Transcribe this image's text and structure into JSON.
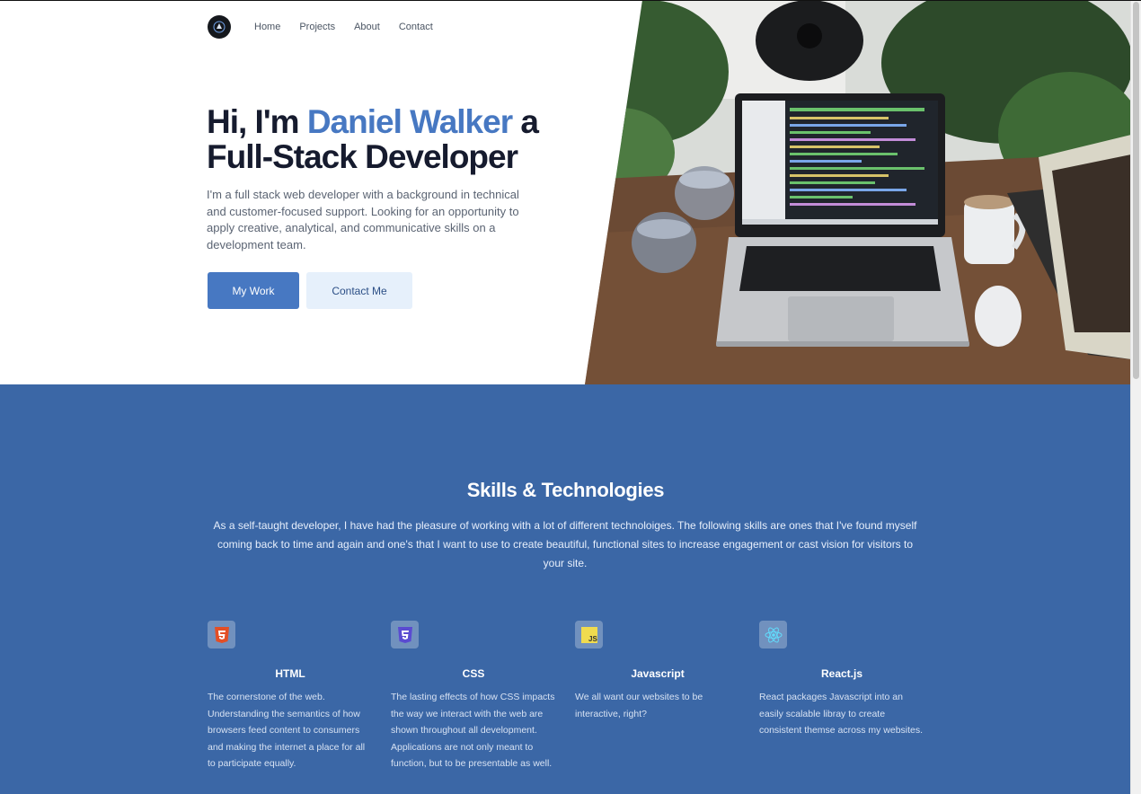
{
  "nav": {
    "logo_alt": "logo",
    "items": [
      "Home",
      "Projects",
      "About",
      "Contact"
    ]
  },
  "hero": {
    "title_prefix": "Hi, I'm ",
    "name": "Daniel Walker",
    "title_suffix_1": " a",
    "title_line2": "Full-Stack Developer",
    "description": "I'm a full stack web developer with a background in technical and customer-focused support. Looking for an opportunity to apply creative, analytical, and communicative skills on a development team.",
    "primary_button": "My Work",
    "secondary_button": "Contact Me",
    "photo_icon": "laptop-desk-photo"
  },
  "skills": {
    "title": "Skills & Technologies",
    "intro": "As a self-taught developer, I have had the pleasure of working with a lot of different technoloiges. The following skills are ones that I've found myself coming back to time and again and one's that I want to use to create beautiful, functional sites to increase engagement or cast vision for visitors to your site.",
    "items": [
      {
        "name": "HTML",
        "icon": "html5-icon",
        "color": "#e34f26",
        "description": "The cornerstone of the web. Understanding the semantics of how browsers feed content to consumers and making the internet a place for all to participate equally."
      },
      {
        "name": "CSS",
        "icon": "css3-icon",
        "color": "#5a4bd1",
        "description": "The lasting effects of how CSS impacts the way we interact with the web are shown throughout all development. Applications are not only meant to function, but to be presentable as well."
      },
      {
        "name": "Javascript",
        "icon": "javascript-icon",
        "color": "#f0db4f",
        "description": "We all want our websites to be interactive, right?"
      },
      {
        "name": "React.js",
        "icon": "react-icon",
        "color": "#61dafb",
        "description": "React packages Javascript into an easily scalable libray to create consistent themse across my websites."
      }
    ]
  },
  "colors": {
    "accent": "#4778c2",
    "skills_bg": "#3b67a6",
    "heading": "#161b2e"
  }
}
